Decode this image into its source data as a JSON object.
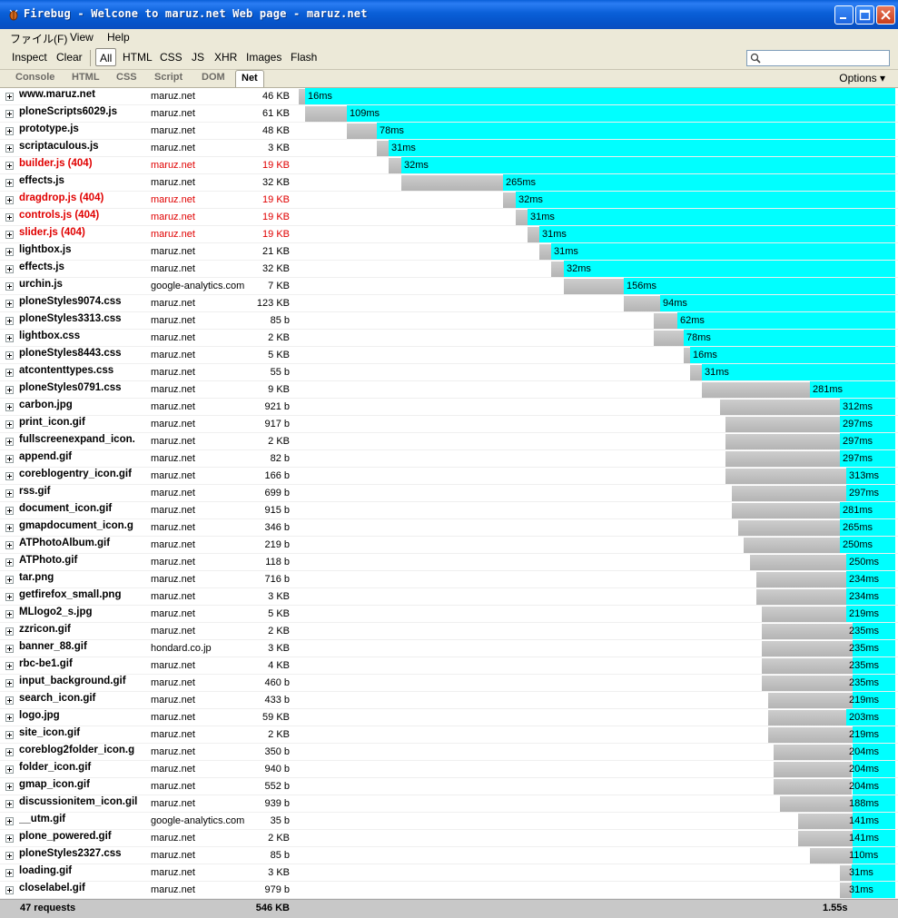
{
  "window": {
    "title": "Firebug - Welcone to maruz.net Web page - maruz.net",
    "colors": {
      "titlebar": "#0a5fd8",
      "timeline_fill": "#00ffff",
      "bar": "#bdbdbd",
      "error_text": "#e00000"
    }
  },
  "menubar": [
    {
      "label": "ファイル(F)"
    },
    {
      "label": "View"
    },
    {
      "label": "Help"
    }
  ],
  "toolbar": {
    "inspect": "Inspect",
    "clear": "Clear",
    "filters": [
      "All",
      "HTML",
      "CSS",
      "JS",
      "XHR",
      "Images",
      "Flash"
    ],
    "active_filter": "All",
    "search_placeholder": ""
  },
  "tabs": {
    "items": [
      "Console",
      "HTML",
      "CSS",
      "Script",
      "DOM",
      "Net"
    ],
    "active": "Net",
    "options": "Options ▾"
  },
  "timeline": {
    "total_ms": 1550
  },
  "requests": [
    {
      "name": "www.maruz.net",
      "domain": "maruz.net",
      "size": "46 KB",
      "start": 0,
      "dur": 16,
      "time": "16ms",
      "error": false
    },
    {
      "name": "ploneScripts6029.js",
      "domain": "maruz.net",
      "size": "61 KB",
      "start": 16,
      "dur": 109,
      "time": "109ms",
      "error": false
    },
    {
      "name": "prototype.js",
      "domain": "maruz.net",
      "size": "48 KB",
      "start": 125,
      "dur": 78,
      "time": "78ms",
      "error": false
    },
    {
      "name": "scriptaculous.js",
      "domain": "maruz.net",
      "size": "3 KB",
      "start": 203,
      "dur": 31,
      "time": "31ms",
      "error": false
    },
    {
      "name": "builder.js (404)",
      "domain": "maruz.net",
      "size": "19 KB",
      "start": 234,
      "dur": 32,
      "time": "32ms",
      "error": true
    },
    {
      "name": "effects.js",
      "domain": "maruz.net",
      "size": "32 KB",
      "start": 266,
      "dur": 265,
      "time": "265ms",
      "error": false
    },
    {
      "name": "dragdrop.js (404)",
      "domain": "maruz.net",
      "size": "19 KB",
      "start": 531,
      "dur": 32,
      "time": "32ms",
      "error": true
    },
    {
      "name": "controls.js (404)",
      "domain": "maruz.net",
      "size": "19 KB",
      "start": 563,
      "dur": 31,
      "time": "31ms",
      "error": true
    },
    {
      "name": "slider.js (404)",
      "domain": "maruz.net",
      "size": "19 KB",
      "start": 594,
      "dur": 31,
      "time": "31ms",
      "error": true
    },
    {
      "name": "lightbox.js",
      "domain": "maruz.net",
      "size": "21 KB",
      "start": 625,
      "dur": 31,
      "time": "31ms",
      "error": false
    },
    {
      "name": "effects.js",
      "domain": "maruz.net",
      "size": "32 KB",
      "start": 656,
      "dur": 32,
      "time": "32ms",
      "error": false
    },
    {
      "name": "urchin.js",
      "domain": "google-analytics.com",
      "size": "7 KB",
      "start": 688,
      "dur": 156,
      "time": "156ms",
      "error": false
    },
    {
      "name": "ploneStyles9074.css",
      "domain": "maruz.net",
      "size": "123 KB",
      "start": 844,
      "dur": 94,
      "time": "94ms",
      "error": false
    },
    {
      "name": "ploneStyles3313.css",
      "domain": "maruz.net",
      "size": "85 b",
      "start": 922,
      "dur": 62,
      "time": "62ms",
      "error": false
    },
    {
      "name": "lightbox.css",
      "domain": "maruz.net",
      "size": "2 KB",
      "start": 922,
      "dur": 78,
      "time": "78ms",
      "error": false
    },
    {
      "name": "ploneStyles8443.css",
      "domain": "maruz.net",
      "size": "5 KB",
      "start": 1000,
      "dur": 16,
      "time": "16ms",
      "error": false
    },
    {
      "name": "atcontenttypes.css",
      "domain": "maruz.net",
      "size": "55 b",
      "start": 1016,
      "dur": 31,
      "time": "31ms",
      "error": false
    },
    {
      "name": "ploneStyles0791.css",
      "domain": "maruz.net",
      "size": "9 KB",
      "start": 1047,
      "dur": 281,
      "time": "281ms",
      "error": false
    },
    {
      "name": "carbon.jpg",
      "domain": "maruz.net",
      "size": "921 b",
      "start": 1094,
      "dur": 312,
      "time": "312ms",
      "error": false
    },
    {
      "name": "print_icon.gif",
      "domain": "maruz.net",
      "size": "917 b",
      "start": 1109,
      "dur": 297,
      "time": "297ms",
      "error": false
    },
    {
      "name": "fullscreenexpand_icon.",
      "domain": "maruz.net",
      "size": "2 KB",
      "start": 1109,
      "dur": 297,
      "time": "297ms",
      "error": false
    },
    {
      "name": "append.gif",
      "domain": "maruz.net",
      "size": "82 b",
      "start": 1109,
      "dur": 297,
      "time": "297ms",
      "error": false
    },
    {
      "name": "coreblogentry_icon.gif",
      "domain": "maruz.net",
      "size": "166 b",
      "start": 1109,
      "dur": 313,
      "time": "313ms",
      "error": false
    },
    {
      "name": "rss.gif",
      "domain": "maruz.net",
      "size": "699 b",
      "start": 1125,
      "dur": 297,
      "time": "297ms",
      "error": false
    },
    {
      "name": "document_icon.gif",
      "domain": "maruz.net",
      "size": "915 b",
      "start": 1125,
      "dur": 281,
      "time": "281ms",
      "error": false
    },
    {
      "name": "gmapdocument_icon.g",
      "domain": "maruz.net",
      "size": "346 b",
      "start": 1141,
      "dur": 265,
      "time": "265ms",
      "error": false
    },
    {
      "name": "ATPhotoAlbum.gif",
      "domain": "maruz.net",
      "size": "219 b",
      "start": 1156,
      "dur": 250,
      "time": "250ms",
      "error": false
    },
    {
      "name": "ATPhoto.gif",
      "domain": "maruz.net",
      "size": "118 b",
      "start": 1172,
      "dur": 250,
      "time": "250ms",
      "error": false
    },
    {
      "name": "tar.png",
      "domain": "maruz.net",
      "size": "716 b",
      "start": 1188,
      "dur": 234,
      "time": "234ms",
      "error": false
    },
    {
      "name": "getfirefox_small.png",
      "domain": "maruz.net",
      "size": "3 KB",
      "start": 1188,
      "dur": 234,
      "time": "234ms",
      "error": false
    },
    {
      "name": "MLlogo2_s.jpg",
      "domain": "maruz.net",
      "size": "5 KB",
      "start": 1203,
      "dur": 219,
      "time": "219ms",
      "error": false
    },
    {
      "name": "zzricon.gif",
      "domain": "maruz.net",
      "size": "2 KB",
      "start": 1203,
      "dur": 235,
      "time": "235ms",
      "error": false
    },
    {
      "name": "banner_88.gif",
      "domain": "hondard.co.jp",
      "size": "3 KB",
      "start": 1203,
      "dur": 235,
      "time": "235ms",
      "error": false
    },
    {
      "name": "rbc-be1.gif",
      "domain": "maruz.net",
      "size": "4 KB",
      "start": 1203,
      "dur": 235,
      "time": "235ms",
      "error": false
    },
    {
      "name": "input_background.gif",
      "domain": "maruz.net",
      "size": "460 b",
      "start": 1203,
      "dur": 235,
      "time": "235ms",
      "error": false
    },
    {
      "name": "search_icon.gif",
      "domain": "maruz.net",
      "size": "433 b",
      "start": 1219,
      "dur": 219,
      "time": "219ms",
      "error": false
    },
    {
      "name": "logo.jpg",
      "domain": "maruz.net",
      "size": "59 KB",
      "start": 1219,
      "dur": 203,
      "time": "203ms",
      "error": false
    },
    {
      "name": "site_icon.gif",
      "domain": "maruz.net",
      "size": "2 KB",
      "start": 1219,
      "dur": 219,
      "time": "219ms",
      "error": false
    },
    {
      "name": "coreblog2folder_icon.g",
      "domain": "maruz.net",
      "size": "350 b",
      "start": 1234,
      "dur": 204,
      "time": "204ms",
      "error": false
    },
    {
      "name": "folder_icon.gif",
      "domain": "maruz.net",
      "size": "940 b",
      "start": 1234,
      "dur": 204,
      "time": "204ms",
      "error": false
    },
    {
      "name": "gmap_icon.gif",
      "domain": "maruz.net",
      "size": "552 b",
      "start": 1234,
      "dur": 204,
      "time": "204ms",
      "error": false
    },
    {
      "name": "discussionitem_icon.gil",
      "domain": "maruz.net",
      "size": "939 b",
      "start": 1250,
      "dur": 188,
      "time": "188ms",
      "error": false
    },
    {
      "name": "__utm.gif",
      "domain": "google-analytics.com",
      "size": "35 b",
      "start": 1297,
      "dur": 141,
      "time": "141ms",
      "error": false
    },
    {
      "name": "plone_powered.gif",
      "domain": "maruz.net",
      "size": "2 KB",
      "start": 1297,
      "dur": 141,
      "time": "141ms",
      "error": false
    },
    {
      "name": "ploneStyles2327.css",
      "domain": "maruz.net",
      "size": "85 b",
      "start": 1328,
      "dur": 110,
      "time": "110ms",
      "error": false
    },
    {
      "name": "loading.gif",
      "domain": "maruz.net",
      "size": "3 KB",
      "start": 1406,
      "dur": 31,
      "time": "31ms",
      "error": false
    },
    {
      "name": "closelabel.gif",
      "domain": "maruz.net",
      "size": "979 b",
      "start": 1406,
      "dur": 31,
      "time": "31ms",
      "error": false
    }
  ],
  "summary": {
    "requests": "47 requests",
    "total_size": "546 KB",
    "total_time": "1.55s"
  }
}
